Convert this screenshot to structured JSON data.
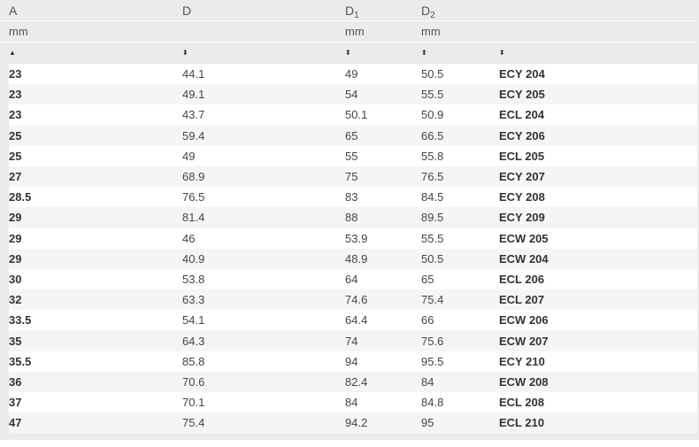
{
  "columns": [
    {
      "name": "A",
      "sub": "",
      "unit": "mm",
      "sort": "▲"
    },
    {
      "name": "D",
      "sub": "",
      "unit": "",
      "sort": "⬍"
    },
    {
      "name": "D",
      "sub": "1",
      "unit": "mm",
      "sort": "⬍"
    },
    {
      "name": "D",
      "sub": "2",
      "unit": "mm",
      "sort": "⬍"
    },
    {
      "name": "",
      "sub": "",
      "unit": "",
      "sort": "⬍"
    }
  ],
  "rows": [
    [
      "23",
      "44.1",
      "49",
      "50.5",
      "ECY 204"
    ],
    [
      "23",
      "49.1",
      "54",
      "55.5",
      "ECY 205"
    ],
    [
      "23",
      "43.7",
      "50.1",
      "50.9",
      "ECL 204"
    ],
    [
      "25",
      "59.4",
      "65",
      "66.5",
      "ECY 206"
    ],
    [
      "25",
      "49",
      "55",
      "55.8",
      "ECL 205"
    ],
    [
      "27",
      "68.9",
      "75",
      "76.5",
      "ECY 207"
    ],
    [
      "28.5",
      "76.5",
      "83",
      "84.5",
      "ECY 208"
    ],
    [
      "29",
      "81.4",
      "88",
      "89.5",
      "ECY 209"
    ],
    [
      "29",
      "46",
      "53.9",
      "55.5",
      "ECW 205"
    ],
    [
      "29",
      "40.9",
      "48.9",
      "50.5",
      "ECW 204"
    ],
    [
      "30",
      "53.8",
      "64",
      "65",
      "ECL 206"
    ],
    [
      "32",
      "63.3",
      "74.6",
      "75.4",
      "ECL 207"
    ],
    [
      "33.5",
      "54.1",
      "64.4",
      "66",
      "ECW 206"
    ],
    [
      "35",
      "64.3",
      "74",
      "75.6",
      "ECW 207"
    ],
    [
      "35.5",
      "85.8",
      "94",
      "95.5",
      "ECY 210"
    ],
    [
      "36",
      "70.6",
      "82.4",
      "84",
      "ECW 208"
    ],
    [
      "37",
      "70.1",
      "84",
      "84.8",
      "ECL 208"
    ],
    [
      "47",
      "75.4",
      "94.2",
      "95",
      "ECL 210"
    ]
  ]
}
